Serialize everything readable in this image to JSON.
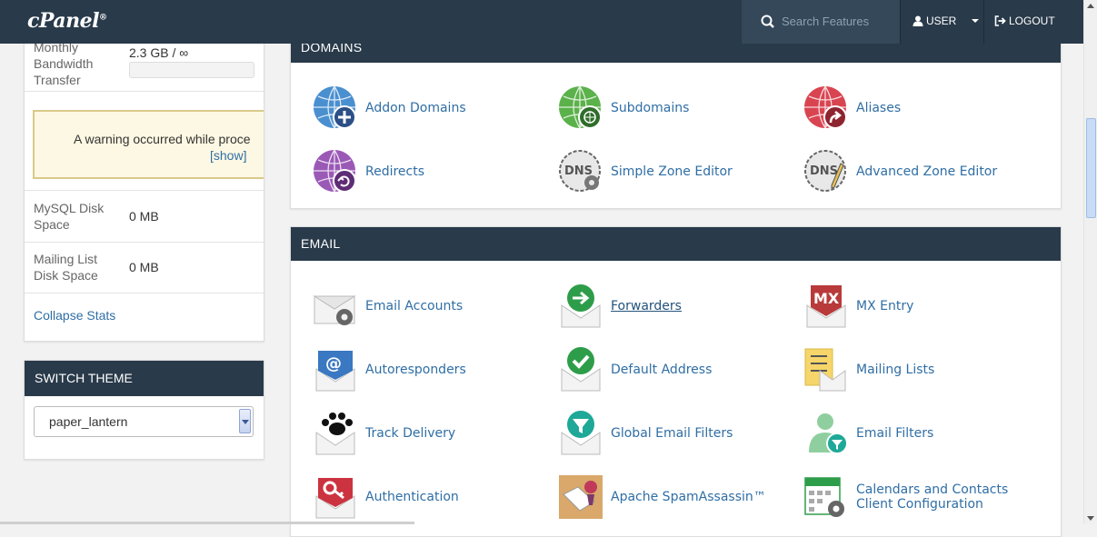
{
  "header": {
    "logo": "cPanel",
    "logo_mark": "®",
    "search_placeholder": "Search Features",
    "user_label": "USER",
    "logout_label": "LOGOUT"
  },
  "stats": {
    "bandwidth": {
      "label": "Monthly Bandwidth Transfer",
      "value": "2.3 GB / ∞",
      "usage_fraction": 0
    },
    "warning": {
      "text": "A warning occurred while proce",
      "link": "[show]"
    },
    "mysql": {
      "label": "MySQL Disk Space",
      "value": "0 MB"
    },
    "mailing": {
      "label": "Mailing List Disk Space",
      "value": "0 MB"
    },
    "collapse_label": "Collapse Stats"
  },
  "theme": {
    "title": "SWITCH THEME",
    "selected": "paper_lantern"
  },
  "domains": {
    "title": "DOMAINS",
    "items": [
      {
        "label": "Addon Domains",
        "icon": "addon-domains-icon",
        "color": "#4a8fcf"
      },
      {
        "label": "Subdomains",
        "icon": "subdomains-icon",
        "color": "#5bb14a"
      },
      {
        "label": "Aliases",
        "icon": "aliases-icon",
        "color": "#d94451"
      },
      {
        "label": "Redirects",
        "icon": "redirects-icon",
        "color": "#9b59b6"
      },
      {
        "label": "Simple Zone Editor",
        "icon": "simple-zone-editor-icon",
        "color": "#555555"
      },
      {
        "label": "Advanced Zone Editor",
        "icon": "advanced-zone-editor-icon",
        "color": "#555555"
      }
    ]
  },
  "email": {
    "title": "EMAIL",
    "items": [
      {
        "label": "Email Accounts",
        "icon": "email-accounts-icon"
      },
      {
        "label": "Forwarders",
        "icon": "forwarders-icon"
      },
      {
        "label": "MX Entry",
        "icon": "mx-entry-icon"
      },
      {
        "label": "Autoresponders",
        "icon": "autoresponders-icon"
      },
      {
        "label": "Default Address",
        "icon": "default-address-icon"
      },
      {
        "label": "Mailing Lists",
        "icon": "mailing-lists-icon"
      },
      {
        "label": "Track Delivery",
        "icon": "track-delivery-icon"
      },
      {
        "label": "Global Email Filters",
        "icon": "global-email-filters-icon"
      },
      {
        "label": "Email Filters",
        "icon": "email-filters-icon"
      },
      {
        "label": "Authentication",
        "icon": "authentication-icon"
      },
      {
        "label": "Apache SpamAssassin™",
        "icon": "spamassassin-icon"
      },
      {
        "label": "Calendars and Contacts Client Configuration",
        "icon": "calendars-contacts-icon"
      }
    ]
  },
  "colors": {
    "header_bg": "#293a4a",
    "link": "#2f6ea5"
  }
}
